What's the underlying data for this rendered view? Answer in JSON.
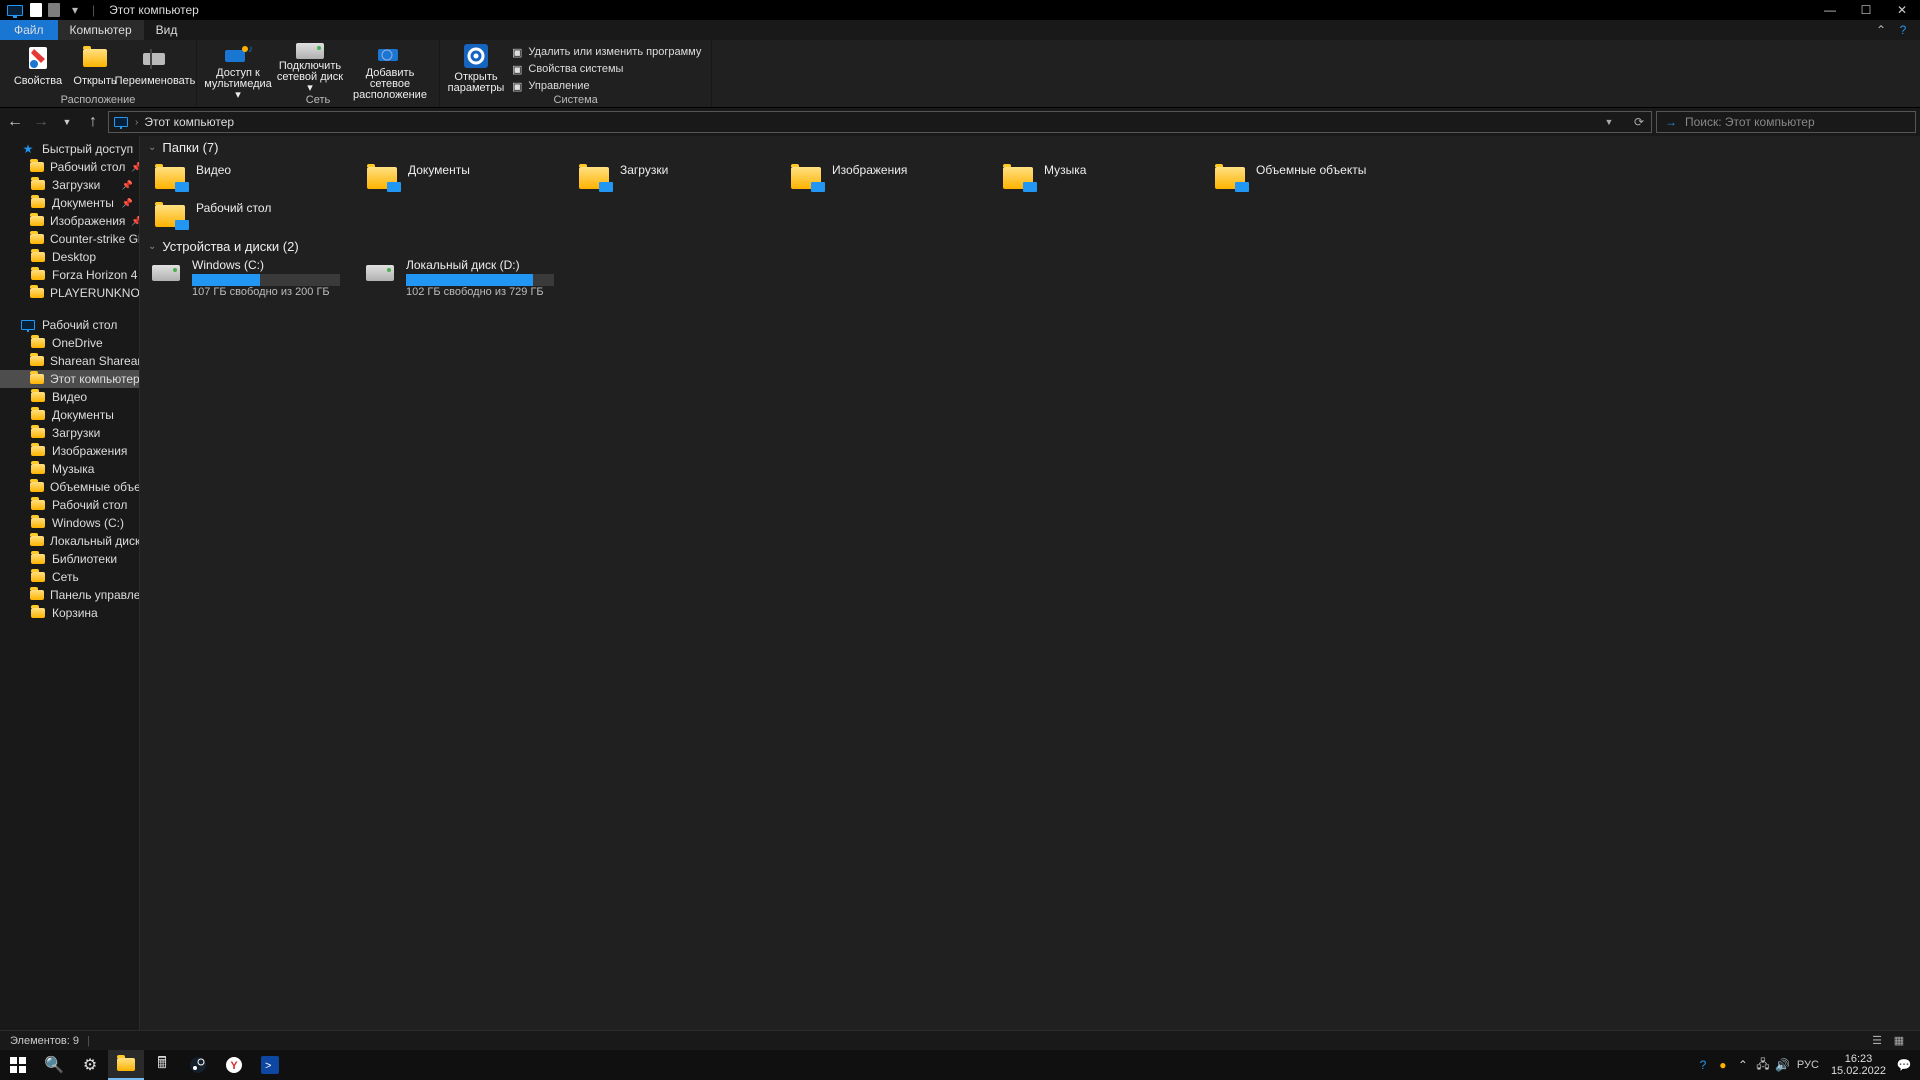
{
  "title": "Этот компьютер",
  "tabs": {
    "file": "Файл",
    "computer": "Компьютер",
    "view": "Вид"
  },
  "ribbon": {
    "location_group": "Расположение",
    "network_group": "Сеть",
    "system_group": "Система",
    "properties": "Свойства",
    "open": "Открыть",
    "rename": "Переименовать",
    "media_access": "Доступ к мультимедиа",
    "map_drive": "Подключить сетевой диск",
    "add_network_location": "Добавить сетевое расположение",
    "open_settings": "Открыть параметры",
    "uninstall_or_change": "Удалить или изменить программу",
    "system_properties": "Свойства системы",
    "manage": "Управление"
  },
  "address": {
    "crumb": "Этот компьютер"
  },
  "search": {
    "placeholder": "Поиск: Этот компьютер"
  },
  "nav": {
    "quick": {
      "label": "Быстрый доступ",
      "items": [
        {
          "label": "Рабочий стол",
          "pin": true
        },
        {
          "label": "Загрузки",
          "pin": true
        },
        {
          "label": "Документы",
          "pin": true
        },
        {
          "label": "Изображения",
          "pin": true
        },
        {
          "label": "Counter-strike Global O"
        },
        {
          "label": "Desktop"
        },
        {
          "label": "Forza Horizon 4"
        },
        {
          "label": "PLAYERUNKNOWN'S BA"
        }
      ]
    },
    "desktop": {
      "label": "Рабочий стол",
      "items": [
        {
          "label": "OneDrive"
        },
        {
          "label": "Sharean Shareann"
        },
        {
          "label": "Этот компьютер",
          "selected": true
        },
        {
          "label": "Видео",
          "sub": true
        },
        {
          "label": "Документы",
          "sub": true
        },
        {
          "label": "Загрузки",
          "sub": true
        },
        {
          "label": "Изображения",
          "sub": true
        },
        {
          "label": "Музыка",
          "sub": true
        },
        {
          "label": "Объемные объекты",
          "sub": true
        },
        {
          "label": "Рабочий стол",
          "sub": true
        },
        {
          "label": "Windows (C:)",
          "sub": true
        },
        {
          "label": "Локальный диск (D:)",
          "sub": true
        },
        {
          "label": "Библиотеки"
        },
        {
          "label": "Сеть"
        },
        {
          "label": "Панель управления"
        },
        {
          "label": "Корзина"
        }
      ]
    }
  },
  "content": {
    "folders_header": "Папки (7)",
    "devices_header": "Устройства и диски (2)",
    "folders": [
      "Видео",
      "Документы",
      "Загрузки",
      "Изображения",
      "Музыка",
      "Объемные объекты",
      "Рабочий стол"
    ],
    "drives": [
      {
        "name": "Windows (C:)",
        "info": "107 ГБ свободно из 200 ГБ",
        "pct": 46
      },
      {
        "name": "Локальный диск (D:)",
        "info": "102 ГБ свободно из 729 ГБ",
        "pct": 86
      }
    ]
  },
  "status": {
    "count": "Элементов: 9"
  },
  "taskbar": {
    "lang": "РУС",
    "time": "16:23",
    "date": "15.02.2022"
  }
}
